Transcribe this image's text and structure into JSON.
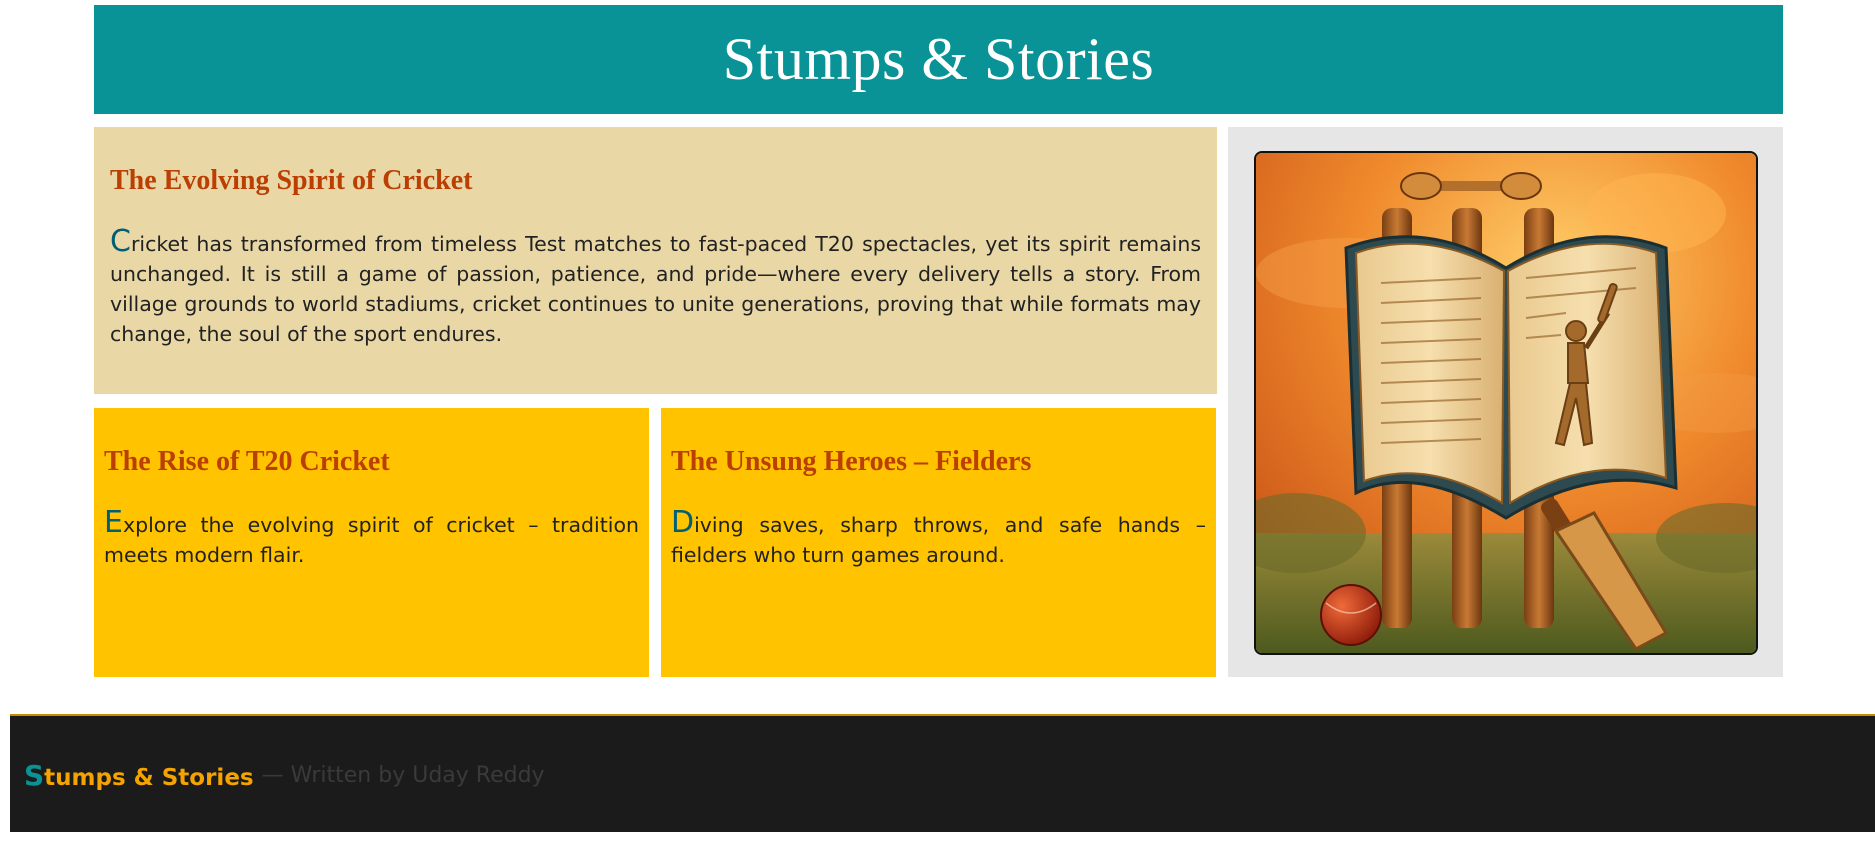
{
  "header": {
    "title": "Stumps & Stories"
  },
  "main_article": {
    "heading": "The Evolving Spirit of Cricket",
    "dropcap": "C",
    "body": "ricket has transformed from timeless Test matches to fast-paced T20 spectacles, yet its spirit remains unchanged. It is still a game of passion, patience, and pride—where every delivery tells a story. From village grounds to world stadiums, cricket continues to unite generations, proving that while formats may change, the soul of the sport endures."
  },
  "cards": [
    {
      "heading": "The Rise of T20 Cricket",
      "dropcap": "E",
      "body": "xplore the evolving spirit of cricket – tradition meets modern flair."
    },
    {
      "heading": "The Unsung Heroes – Fielders",
      "dropcap": "D",
      "body": "iving saves, sharp throws, and safe hands – fielders who turn games around."
    }
  ],
  "footer": {
    "brand_first_letter": "S",
    "brand_rest": "tumps & Stories",
    "credit": "— Written by Uday Reddy"
  },
  "colors": {
    "header_bg": "#0a9396",
    "main_panel_bg": "#e9d8a6",
    "card_bg": "#ffc300",
    "heading": "#bb3e03",
    "dropcap": "#005f73",
    "footer_bg": "#1b1b1b",
    "footer_brand": "#f4a300"
  },
  "image": {
    "subject": "cricket-book-illustration"
  }
}
